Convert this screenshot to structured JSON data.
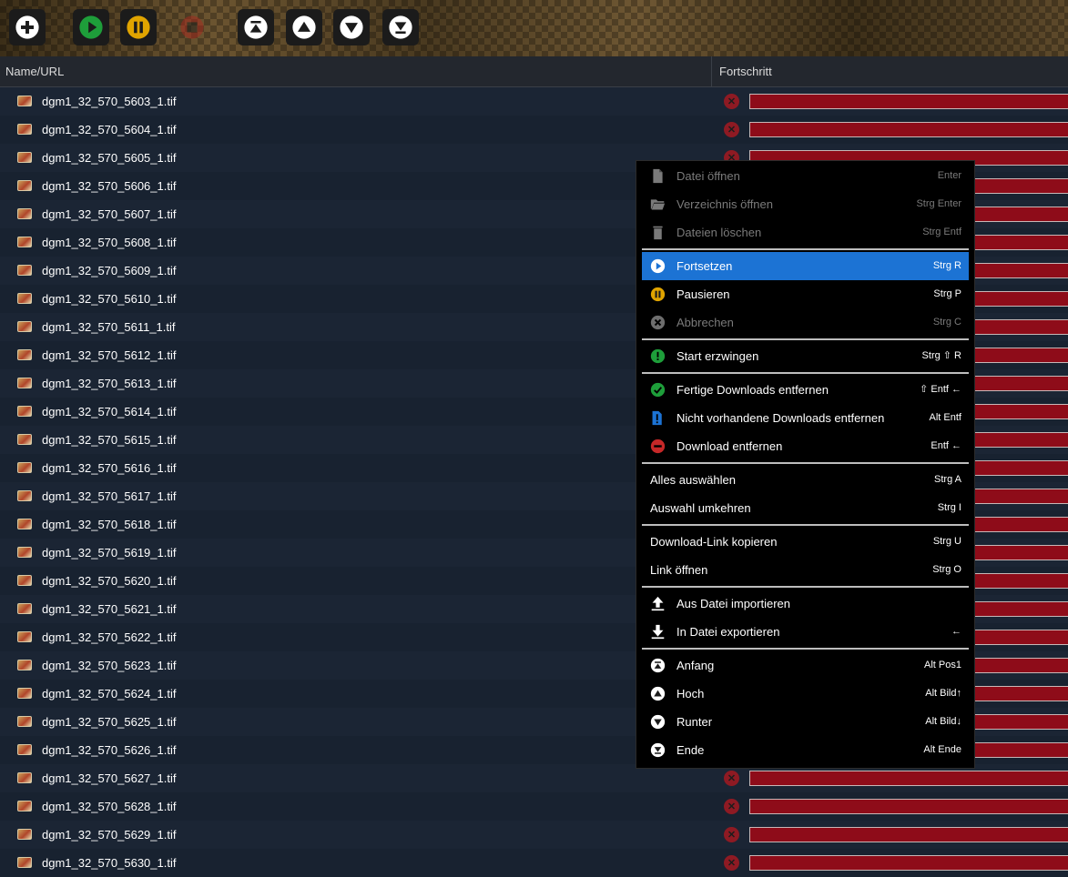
{
  "toolbar": {
    "buttons": [
      {
        "icon": "add-icon"
      },
      {
        "icon": "play-icon"
      },
      {
        "icon": "pause-icon"
      },
      {
        "icon": "stop-icon"
      },
      {
        "icon": "move-top-icon"
      },
      {
        "icon": "move-up-icon"
      },
      {
        "icon": "move-down-icon"
      },
      {
        "icon": "move-bottom-icon"
      }
    ]
  },
  "header": {
    "name_col": "Name/URL",
    "progress_col": "Fortschritt"
  },
  "files": [
    "dgm1_32_570_5603_1.tif",
    "dgm1_32_570_5604_1.tif",
    "dgm1_32_570_5605_1.tif",
    "dgm1_32_570_5606_1.tif",
    "dgm1_32_570_5607_1.tif",
    "dgm1_32_570_5608_1.tif",
    "dgm1_32_570_5609_1.tif",
    "dgm1_32_570_5610_1.tif",
    "dgm1_32_570_5611_1.tif",
    "dgm1_32_570_5612_1.tif",
    "dgm1_32_570_5613_1.tif",
    "dgm1_32_570_5614_1.tif",
    "dgm1_32_570_5615_1.tif",
    "dgm1_32_570_5616_1.tif",
    "dgm1_32_570_5617_1.tif",
    "dgm1_32_570_5618_1.tif",
    "dgm1_32_570_5619_1.tif",
    "dgm1_32_570_5620_1.tif",
    "dgm1_32_570_5621_1.tif",
    "dgm1_32_570_5622_1.tif",
    "dgm1_32_570_5623_1.tif",
    "dgm1_32_570_5624_1.tif",
    "dgm1_32_570_5625_1.tif",
    "dgm1_32_570_5626_1.tif",
    "dgm1_32_570_5627_1.tif",
    "dgm1_32_570_5628_1.tif",
    "dgm1_32_570_5629_1.tif",
    "dgm1_32_570_5630_1.tif"
  ],
  "menu": [
    {
      "type": "item",
      "label": "Datei öffnen",
      "key": "Enter",
      "icon": "file-icon",
      "disabled": true
    },
    {
      "type": "item",
      "label": "Verzeichnis öffnen",
      "key": "Strg Enter",
      "icon": "folder-icon",
      "disabled": true
    },
    {
      "type": "item",
      "label": "Dateien löschen",
      "key": "Strg Entf",
      "icon": "trash-icon",
      "disabled": true
    },
    {
      "type": "sep"
    },
    {
      "type": "item",
      "label": "Fortsetzen",
      "key": "Strg R",
      "icon": "resume-icon",
      "active": true
    },
    {
      "type": "item",
      "label": "Pausieren",
      "key": "Strg P",
      "icon": "pause-icon"
    },
    {
      "type": "item",
      "label": "Abbrechen",
      "key": "Strg C",
      "icon": "cancel-icon",
      "disabled": true
    },
    {
      "type": "sep"
    },
    {
      "type": "item",
      "label": "Start erzwingen",
      "key": "Strg ⇧ R",
      "icon": "force-start-icon"
    },
    {
      "type": "sep"
    },
    {
      "type": "item",
      "label": "Fertige Downloads entfernen",
      "key": "⇧ Entf  ←",
      "icon": "check-icon"
    },
    {
      "type": "item",
      "label": "Nicht vorhandene Downloads entfernen",
      "key": "Alt Entf",
      "icon": "missing-file-icon"
    },
    {
      "type": "item",
      "label": "Download entfernen",
      "key": "Entf  ←",
      "icon": "remove-icon"
    },
    {
      "type": "sep"
    },
    {
      "type": "item",
      "label": "Alles auswählen",
      "key": "Strg A",
      "noicon": true
    },
    {
      "type": "item",
      "label": "Auswahl umkehren",
      "key": "Strg I",
      "noicon": true
    },
    {
      "type": "sep"
    },
    {
      "type": "item",
      "label": "Download-Link kopieren",
      "key": "Strg U",
      "noicon": true
    },
    {
      "type": "item",
      "label": "Link öffnen",
      "key": "Strg O",
      "noicon": true
    },
    {
      "type": "sep"
    },
    {
      "type": "item",
      "label": "Aus Datei importieren",
      "key": "",
      "icon": "import-icon"
    },
    {
      "type": "item",
      "label": "In Datei exportieren",
      "key": "←",
      "icon": "export-icon"
    },
    {
      "type": "sep"
    },
    {
      "type": "item",
      "label": "Anfang",
      "key": "Alt Pos1",
      "icon": "move-top-icon"
    },
    {
      "type": "item",
      "label": "Hoch",
      "key": "Alt Bild↑",
      "icon": "move-up-icon"
    },
    {
      "type": "item",
      "label": "Runter",
      "key": "Alt Bild↓",
      "icon": "move-down-icon"
    },
    {
      "type": "item",
      "label": "Ende",
      "key": "Alt Ende",
      "icon": "move-bottom-icon"
    }
  ],
  "colors": {
    "accent": "#1c73d4",
    "error": "#8e0c19",
    "play": "#1e9e3a",
    "pause": "#e0a400"
  }
}
